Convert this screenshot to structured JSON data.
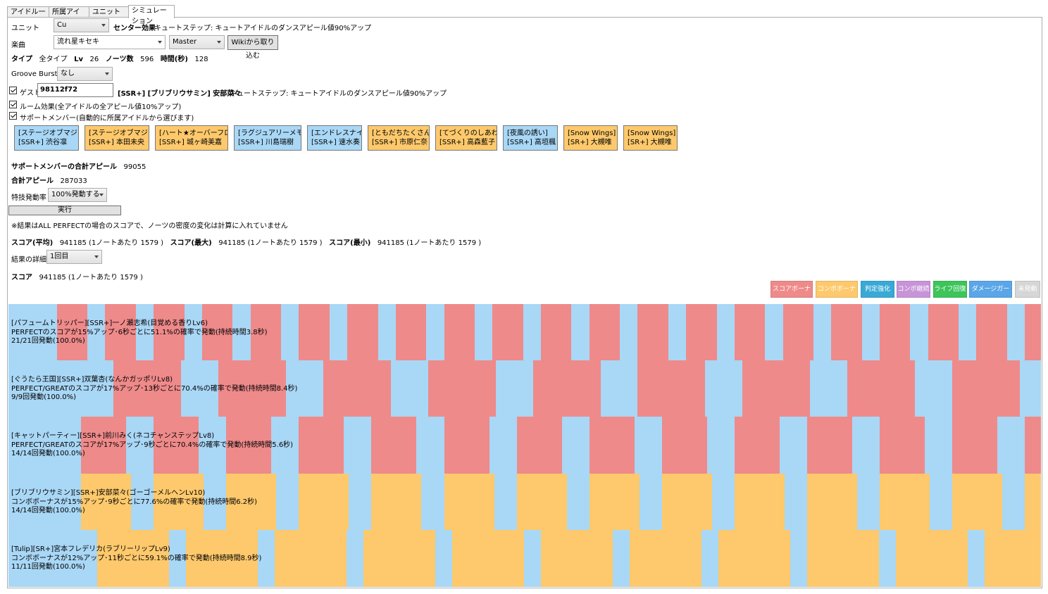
{
  "tabs": [
    {
      "label": "アイドル一覧",
      "active": false
    },
    {
      "label": "所属アイドル",
      "active": false
    },
    {
      "label": "ユニット編成",
      "active": false
    },
    {
      "label": "シミュレーション",
      "active": true
    }
  ],
  "unit": {
    "label": "ユニット",
    "value": "Cu",
    "center_effect_label": "センター効果",
    "center_effect_value": "キュートステップ: キュートアイドルのダンスアピール値90%アップ"
  },
  "song": {
    "label": "楽曲",
    "value": "流れ星キセキ",
    "difficulty": "Master",
    "wiki_button": "Wikiから取り込む"
  },
  "song_info": {
    "type_label": "タイプ",
    "type_value": "全タイプ",
    "lv_label": "Lv",
    "lv_value": "26",
    "notes_label": "ノーツ数",
    "notes_value": "596",
    "time_label": "時間(秒)",
    "time_value": "128"
  },
  "groove": {
    "label": "Groove Burst",
    "value": "なし"
  },
  "guest": {
    "label": "ゲスト",
    "id": "98112f72",
    "card": "[SSR+] [ブリブリウサミン] 安部菜々",
    "skill": "キュートステップ: キュートアイドルのダンスアピール値90%アップ"
  },
  "room_effect": {
    "label": "ルーム効果(全アイドルの全アピール値10%アップ)"
  },
  "support_member": {
    "label": "サポートメンバー(自動的に所属アイドルから選びます)"
  },
  "cards": [
    {
      "line1": "[ステージオブマジック]",
      "line2": "[SSR+] 渋谷凛",
      "color": "#a9d7f6"
    },
    {
      "line1": "[ステージオブマジック]",
      "line2": "[SSR+] 本田未央",
      "color": "#fdc96c"
    },
    {
      "line1": "[ハート★オーバーフロー]",
      "line2": "[SSR+] 城ヶ崎美嘉",
      "color": "#fdc96c"
    },
    {
      "line1": "[ラグジュアリーメモリー]",
      "line2": "[SSR+] 川島瑞樹",
      "color": "#a9d7f6"
    },
    {
      "line1": "[エンドレスナイト]",
      "line2": "[SSR+] 速水奏",
      "color": "#a9d7f6"
    },
    {
      "line1": "[ともだちたくさん]",
      "line2": "[SSR+] 市原仁奈",
      "color": "#fdc96c"
    },
    {
      "line1": "[てづくりのしあわせ]",
      "line2": "[SSR+] 高森藍子",
      "color": "#fdc96c"
    },
    {
      "line1": "[夜風の誘い]",
      "line2": "[SSR+] 高垣楓",
      "color": "#a9d7f6"
    },
    {
      "line1": "[Snow Wings]",
      "line2": "[SR+] 大槻唯",
      "color": "#fdc96c"
    },
    {
      "line1": "[Snow Wings]",
      "line2": "[SR+] 大槻唯",
      "color": "#fdc96c"
    }
  ],
  "support_total": {
    "label": "サポートメンバーの合計アピール",
    "value": "99055"
  },
  "total_appeal": {
    "label": "合計アピール",
    "value": "287033"
  },
  "skill_rate": {
    "label": "特技発動率",
    "value": "100%発動する"
  },
  "run_button": "実行",
  "note": "※結果はALL PERFECTの場合のスコアで、ノーツの密度の変化は計算に入れていません",
  "scores": {
    "avg_label": "スコア(平均)",
    "avg_value": "941185 (1ノートあたり 1579 )",
    "max_label": "スコア(最大)",
    "max_value": "941185 (1ノートあたり 1579 )",
    "min_label": "スコア(最小)",
    "min_value": "941185 (1ノートあたり 1579 )"
  },
  "result_detail": {
    "label": "結果の詳細",
    "value": "1回目"
  },
  "score": {
    "label": "スコア",
    "value": "941185 (1ノートあたり 1579 )"
  },
  "legend": [
    {
      "label": "スコアボーナス",
      "color": "#ef8a8a"
    },
    {
      "label": "コンボボーナス",
      "color": "#fdc96c"
    },
    {
      "label": "判定強化",
      "color": "#39a9d5"
    },
    {
      "label": "コンボ継続",
      "color": "#c894d8"
    },
    {
      "label": "ライフ回復",
      "color": "#3dc45a"
    },
    {
      "label": "ダメージガード",
      "color": "#5aa6e8"
    },
    {
      "label": "未発動",
      "color": "#d6d6d6"
    }
  ],
  "timeline": {
    "song_seconds": 128,
    "background_color": "#a9d7f6",
    "lanes": [
      {
        "line1": "[パフュームトリッパー][SSR+]一ノ瀬志希(目覚める香りLv6)",
        "line2": "PERFECTのスコアが15%アップ･6秒ごとに51.1%の確率で発動(持続時間3.8秒)",
        "line3": "21/21回発動(100.0%)",
        "color": "#ef8a8a",
        "interval": 6,
        "duration": 3.8,
        "count": 21
      },
      {
        "line1": "[ぐうたら王国][SSR+]双葉杏(なんかガッポリLv8)",
        "line2": "PERFECT/GREATのスコアが17%アップ･13秒ごとに70.4%の確率で発動(持続時間8.4秒)",
        "line3": "9/9回発動(100.0%)",
        "color": "#ef8a8a",
        "interval": 13,
        "duration": 8.4,
        "count": 9
      },
      {
        "line1": "[キャットパーティー][SSR+]前川みく(ネコチャンステップLv8)",
        "line2": "PERFECT/GREATのスコアが17%アップ･9秒ごとに70.4%の確率で発動(持続時間5.6秒)",
        "line3": "14/14回発動(100.0%)",
        "color": "#ef8a8a",
        "interval": 9,
        "duration": 5.6,
        "count": 14
      },
      {
        "line1": "[ブリブリウサミン][SSR+]安部菜々(ゴーゴーメルヘンLv10)",
        "line2": "コンボボーナスが15%アップ･9秒ごとに77.6%の確率で発動(持続時間6.2秒)",
        "line3": "14/14回発動(100.0%)",
        "color": "#fdc96c",
        "interval": 9,
        "duration": 6.2,
        "count": 14
      },
      {
        "line1": "[Tulip][SR+]宮本フレデリカ(ラブリーリップLv9)",
        "line2": "コンボボーナスが12%アップ･11秒ごとに59.1%の確率で発動(持続時間8.9秒)",
        "line3": "11/11回発動(100.0%)",
        "color": "#fdc96c",
        "interval": 11,
        "duration": 8.9,
        "count": 11
      }
    ]
  }
}
